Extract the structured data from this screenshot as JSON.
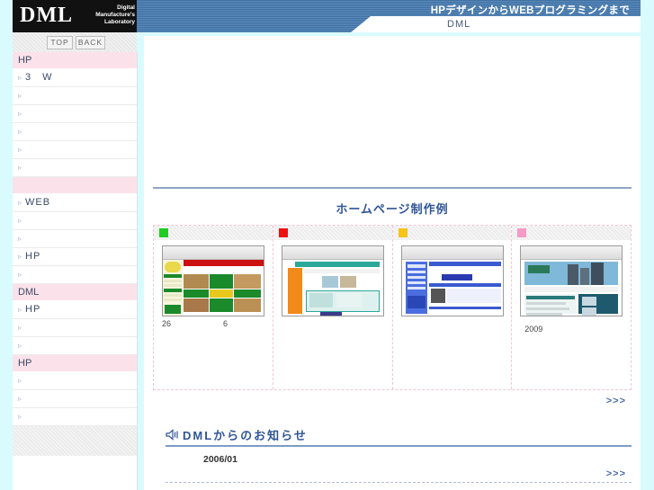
{
  "site": {
    "logo_main": "DML",
    "logo_sub": "Digital Manufacture's Laboratory",
    "banner_tagline": "HPデザインからWEBプログラミングまで",
    "banner_name": "DML"
  },
  "navbar": {
    "top_label": "TOP",
    "back_label": "BACK"
  },
  "sidebar": {
    "sections": [
      {
        "header": "HP",
        "items": [
          {
            "label": "3　W"
          },
          {
            "label": ""
          },
          {
            "label": ""
          },
          {
            "label": ""
          },
          {
            "label": ""
          },
          {
            "label": ""
          }
        ]
      },
      {
        "header": "",
        "items": [
          {
            "label": "WEB"
          },
          {
            "label": ""
          },
          {
            "label": ""
          },
          {
            "label": "HP"
          },
          {
            "label": ""
          }
        ]
      },
      {
        "header": "DML",
        "items": [
          {
            "label": "HP"
          },
          {
            "label": ""
          },
          {
            "label": ""
          }
        ]
      },
      {
        "header": "HP",
        "items": [
          {
            "label": ""
          },
          {
            "label": ""
          },
          {
            "label": ""
          }
        ]
      }
    ],
    "bullet_glyph": "▹"
  },
  "main": {
    "gallery_title": "ホームページ制作例",
    "gallery_more": ">>>",
    "cells": [
      {
        "chip_color": "#22cc22",
        "caption_left": "26",
        "caption_right": "6"
      },
      {
        "chip_color": "#ee1111",
        "caption_left": "",
        "caption_right": ""
      },
      {
        "chip_color": "#f5c518",
        "caption_left": "",
        "caption_right": ""
      },
      {
        "chip_color": "#f79ac6",
        "caption_alt": "2009"
      }
    ],
    "news_title": "DMLからのお知らせ",
    "news_icon": "speaker-icon",
    "news_date": "2006/01",
    "news_more": ">>>"
  },
  "colors": {
    "banner_blue": "#3f71a5",
    "accent_pink": "#fbe2ea",
    "heading_blue": "#2f5596",
    "page_bg": "#d9fbfd"
  }
}
